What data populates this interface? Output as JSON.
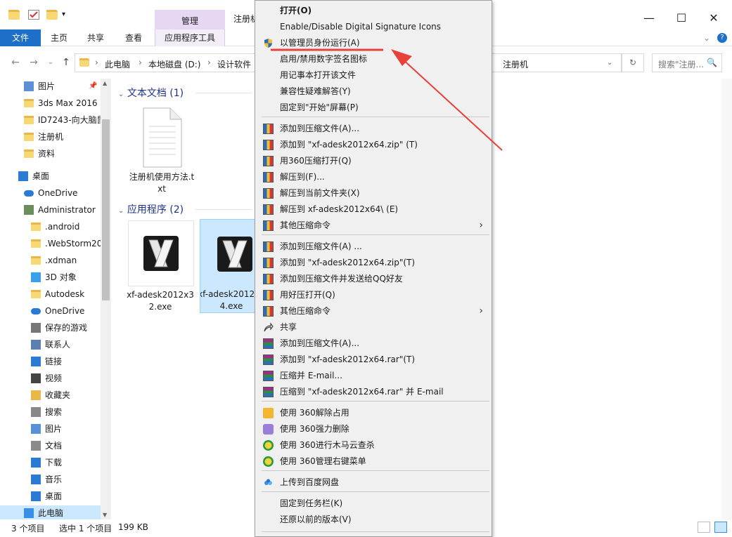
{
  "titlebar": {
    "context_tab": "管理",
    "title": "注册机",
    "min": "—",
    "max": "☐",
    "close": "✕"
  },
  "ribbon": {
    "tabs": [
      "文件",
      "主页",
      "共享",
      "查看",
      "应用程序工具"
    ],
    "help": "?"
  },
  "address": {
    "segments": [
      "此电脑",
      "本地磁盘 (D:)",
      "设计软件",
      "注册机"
    ],
    "search_placeholder": "搜索\"注册...",
    "search_icon": "🔍"
  },
  "nav": {
    "items": [
      {
        "label": "图片",
        "icon": "pictures-icon"
      },
      {
        "label": "3ds Max 2016",
        "icon": "folder-icon"
      },
      {
        "label": "ID7243-向大脑鼠",
        "icon": "folder-icon"
      },
      {
        "label": "注册机",
        "icon": "folder-icon"
      },
      {
        "label": "资料",
        "icon": "folder-icon"
      },
      {
        "label": "桌面",
        "icon": "desktop-icon"
      },
      {
        "label": "OneDrive",
        "icon": "onedrive-icon"
      },
      {
        "label": "Administrator",
        "icon": "user-icon"
      },
      {
        "label": ".android",
        "icon": "folder-icon"
      },
      {
        "label": ".WebStorm20",
        "icon": "folder-icon"
      },
      {
        "label": ".xdman",
        "icon": "folder-icon"
      },
      {
        "label": "3D 对象",
        "icon": "3d-objects-icon"
      },
      {
        "label": "Autodesk",
        "icon": "folder-icon"
      },
      {
        "label": "OneDrive",
        "icon": "onedrive-icon"
      },
      {
        "label": "保存的游戏",
        "icon": "saved-games-icon"
      },
      {
        "label": "联系人",
        "icon": "contacts-icon"
      },
      {
        "label": "链接",
        "icon": "links-icon"
      },
      {
        "label": "视频",
        "icon": "videos-icon"
      },
      {
        "label": "收藏夹",
        "icon": "favorites-icon"
      },
      {
        "label": "搜索",
        "icon": "search-icon"
      },
      {
        "label": "图片",
        "icon": "pictures-icon"
      },
      {
        "label": "文档",
        "icon": "documents-icon"
      },
      {
        "label": "下载",
        "icon": "downloads-icon"
      },
      {
        "label": "音乐",
        "icon": "music-icon"
      },
      {
        "label": "桌面",
        "icon": "desktop-icon"
      },
      {
        "label": "此电脑",
        "icon": "this-pc-icon"
      }
    ]
  },
  "content": {
    "groups": [
      {
        "title": "文本文档 (1)"
      },
      {
        "title": "应用程序 (2)"
      }
    ],
    "files": [
      {
        "name": "注册机使用方法.txt"
      },
      {
        "name": "xf-adesk2012x32.exe"
      },
      {
        "name": "xf-adesk2012x64.exe"
      }
    ]
  },
  "status": {
    "count": "3 个项目",
    "selected": "选中 1 个项目",
    "size": "199 KB"
  },
  "menu": {
    "items": [
      {
        "label": "打开(O)"
      },
      {
        "label": "Enable/Disable Digital Signature Icons"
      },
      {
        "label": "以管理员身份运行(A)"
      },
      {
        "label": "启用/禁用数字签名图标"
      },
      {
        "label": "用记事本打开该文件"
      },
      {
        "label": "兼容性疑难解答(Y)"
      },
      {
        "label": "固定到\"开始\"屏幕(P)"
      },
      {
        "label": "添加到压缩文件(A)..."
      },
      {
        "label": "添加到 \"xf-adesk2012x64.zip\" (T)"
      },
      {
        "label": "用360压缩打开(Q)"
      },
      {
        "label": "解压到(F)..."
      },
      {
        "label": "解压到当前文件夹(X)"
      },
      {
        "label": "解压到 xf-adesk2012x64\\ (E)"
      },
      {
        "label": "其他压缩命令"
      },
      {
        "label": "添加到压缩文件(A) ..."
      },
      {
        "label": "添加到 \"xf-adesk2012x64.zip\"(T)"
      },
      {
        "label": "添加到压缩文件并发送给QQ好友"
      },
      {
        "label": "用好压打开(Q)"
      },
      {
        "label": "其他压缩命令"
      },
      {
        "label": "共享"
      },
      {
        "label": "添加到压缩文件(A)..."
      },
      {
        "label": "添加到 \"xf-adesk2012x64.rar\"(T)"
      },
      {
        "label": "压缩并 E-mail..."
      },
      {
        "label": "压缩到 \"xf-adesk2012x64.rar\" 并 E-mail"
      },
      {
        "label": "使用 360解除占用"
      },
      {
        "label": "使用 360强力删除"
      },
      {
        "label": "使用 360进行木马云查杀"
      },
      {
        "label": "使用 360管理右键菜单"
      },
      {
        "label": "上传到百度网盘"
      },
      {
        "label": "固定到任务栏(K)"
      },
      {
        "label": "还原以前的版本(V)"
      }
    ],
    "submenu_arrow": "›"
  },
  "colors": {
    "accent": "#1e6fc7",
    "selection": "#cce8ff",
    "annotation": "#e8403a",
    "context_tab": "#e6d8f2"
  }
}
